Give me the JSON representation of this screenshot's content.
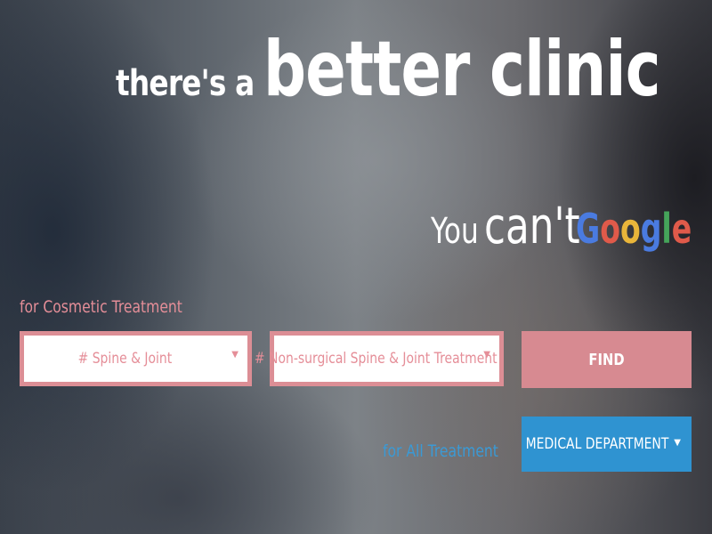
{
  "hero": {
    "headline_small": "there's a",
    "headline_big": "better clinic",
    "sub_you": "You",
    "sub_cant": "can't",
    "google_letters": [
      "G",
      "o",
      "o",
      "g",
      "l",
      "e"
    ]
  },
  "search": {
    "cosmetic_label": "for Cosmetic Treatment",
    "category_select": "# Spine & Joint",
    "treatment_select": "# Non-surgical Spine & Joint Treatment",
    "find_label": "FIND",
    "all_label": "for All Treatment",
    "department_select": "MEDICAL DEPARTMENT"
  },
  "icons": {
    "dropdown_arrow": "▼"
  },
  "colors": {
    "accent_pink": "#dc8e95",
    "accent_blue": "#2f93d1",
    "google_blue": "#4a7be0",
    "google_red": "#e05a4a",
    "google_yellow": "#e9b53a",
    "google_green": "#45a45a"
  }
}
